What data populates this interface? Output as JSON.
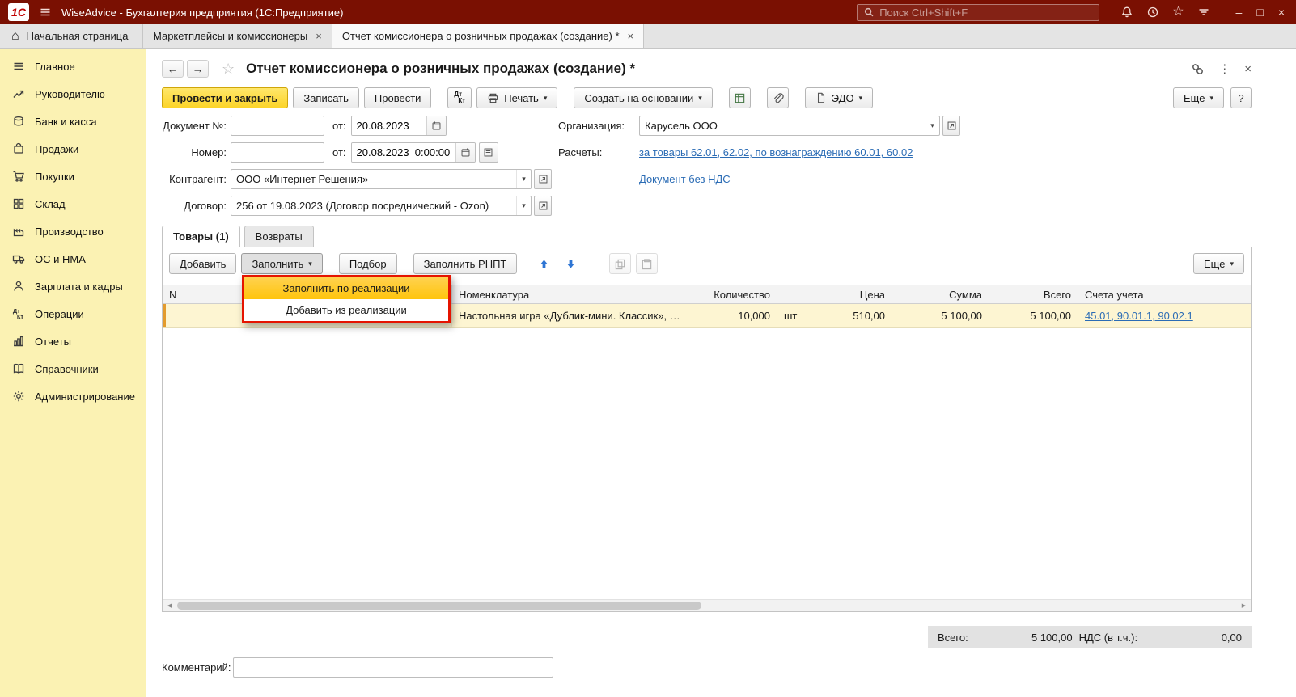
{
  "colors": {
    "titlebar_bg": "#7a1002",
    "sidebar_bg": "#fbf2b3",
    "primary_btn": "#fcd429",
    "selected_row": "#fdf5d2",
    "row_accent": "#e39b2d",
    "menu_highlight": "#ffc40c",
    "annotation": "#e51400",
    "link": "#2b6cb5"
  },
  "icons": {
    "close": "×",
    "minimize": "–",
    "maximize": "□",
    "star": "☆",
    "back": "←",
    "forward": "→",
    "dots": "⋮",
    "caret": "▾",
    "home": "⌂",
    "scroll_left": "◀",
    "scroll_right": "▶"
  },
  "window": {
    "logo": "1С",
    "title": "WiseAdvice - Бухгалтерия предприятия  (1С:Предприятие)",
    "search_placeholder": "Поиск Ctrl+Shift+F"
  },
  "tabbar": {
    "home": "Начальная страница",
    "tabs": [
      {
        "label": "Маркетплейсы и комиссионеры"
      },
      {
        "label": "Отчет комиссионера о розничных продажах (создание) *"
      }
    ]
  },
  "sidebar": {
    "items": [
      {
        "label": "Главное"
      },
      {
        "label": "Руководителю"
      },
      {
        "label": "Банк и касса"
      },
      {
        "label": "Продажи"
      },
      {
        "label": "Покупки"
      },
      {
        "label": "Склад"
      },
      {
        "label": "Производство"
      },
      {
        "label": "ОС и НМА"
      },
      {
        "label": "Зарплата и кадры"
      },
      {
        "label": "Операции"
      },
      {
        "label": "Отчеты"
      },
      {
        "label": "Справочники"
      },
      {
        "label": "Администрирование"
      }
    ]
  },
  "doc": {
    "title": "Отчет комиссионера о розничных продажах (создание) *",
    "toolbar": {
      "post_close": "Провести и закрыть",
      "write": "Записать",
      "post": "Провести",
      "dtkt_top": "Дт",
      "dtkt_bottom": "Кт",
      "print": "Печать",
      "create_based_on": "Создать на основании",
      "edo": "ЭДО",
      "more": "Еще",
      "help": "?"
    },
    "fields": {
      "doc_no_label": "Документ №:",
      "from_label": "от:",
      "date_value": "20.08.2023",
      "number_label": "Номер:",
      "datetime_value": "20.08.2023  0:00:00",
      "counterparty_label": "Контрагент:",
      "counterparty_value": "ООО «Интернет Решения»",
      "contract_label": "Договор:",
      "contract_value": "256 от 19.08.2023 (Договор посреднический - Ozon)",
      "org_label": "Организация:",
      "org_value": "Карусель ООО",
      "settlements_label": "Расчеты:",
      "settlements_link": "за товары 62.01, 62.02, по вознаграждению 60.01, 60.02",
      "no_vat_link": "Документ без НДС"
    },
    "tabs": [
      {
        "label": "Товары (1)"
      },
      {
        "label": "Возвраты"
      }
    ],
    "grid_toolbar": {
      "add": "Добавить",
      "fill": "Заполнить",
      "pick": "Подбор",
      "fill_rnpt": "Заполнить РНПТ",
      "more": "Еще"
    },
    "fill_menu": [
      {
        "label": "Заполнить по реализации"
      },
      {
        "label": "Добавить из реализации"
      }
    ],
    "table": {
      "headers": {
        "n": "N",
        "nomenclature": "Номенклатура",
        "quantity": "Количество",
        "unit": "",
        "price": "Цена",
        "sum": "Сумма",
        "total": "Всего",
        "accounts": "Счета учета"
      },
      "rows": [
        {
          "n": "",
          "nomenclature": "Настольная игра «Дублик-мини. Классик», …",
          "quantity": "10,000",
          "unit": "шт",
          "price": "510,00",
          "sum": "5 100,00",
          "total": "5 100,00",
          "accounts": "45.01, 90.01.1, 90.02.1"
        }
      ]
    },
    "totals": {
      "total_label": "Всего:",
      "total_value": "5 100,00",
      "vat_label": "НДС (в т.ч.):",
      "vat_value": "0,00"
    },
    "comment_label": "Комментарий:"
  }
}
